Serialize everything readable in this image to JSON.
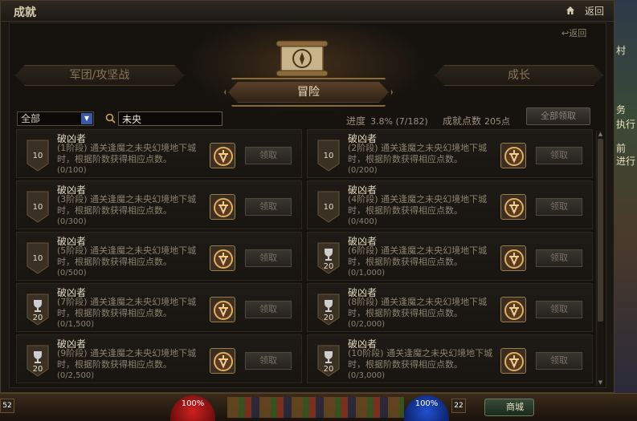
{
  "window": {
    "title": "成就",
    "back_label": "返回"
  },
  "panel": {
    "back_label": "返回"
  },
  "tabs": [
    {
      "label": "军团/攻坚战",
      "active": false
    },
    {
      "label": "冒险",
      "active": true
    },
    {
      "label": "成长",
      "active": false
    }
  ],
  "filter": {
    "selected": "全部",
    "search_value": "未央"
  },
  "summary": {
    "progress_label": "进度",
    "progress_value": "3.8% (7/182)",
    "points_label": "成就点数",
    "points_value": "205点",
    "claim_all_label": "全部领取"
  },
  "achievements": [
    {
      "name": "破凶者",
      "stage": "(1阶段)",
      "desc": "通关逢魔之未央幻境地下城时，根据阶数获得相应点数。",
      "progress": "(0/100)",
      "points": "10",
      "claim_label": "领取"
    },
    {
      "name": "破凶者",
      "stage": "(2阶段)",
      "desc": "通关逢魔之未央幻境地下城时，根据阶数获得相应点数。",
      "progress": "(0/200)",
      "points": "10",
      "claim_label": "领取"
    },
    {
      "name": "破凶者",
      "stage": "(3阶段)",
      "desc": "通关逢魔之未央幻境地下城时，根据阶数获得相应点数。",
      "progress": "(0/300)",
      "points": "10",
      "claim_label": "领取"
    },
    {
      "name": "破凶者",
      "stage": "(4阶段)",
      "desc": "通关逢魔之未央幻境地下城时，根据阶数获得相应点数。",
      "progress": "(0/400)",
      "points": "10",
      "claim_label": "领取"
    },
    {
      "name": "破凶者",
      "stage": "(5阶段)",
      "desc": "通关逢魔之未央幻境地下城时，根据阶数获得相应点数。",
      "progress": "(0/500)",
      "points": "10",
      "claim_label": "领取"
    },
    {
      "name": "破凶者",
      "stage": "(6阶段)",
      "desc": "通关逢魔之未央幻境地下城时，根据阶数获得相应点数。",
      "progress": "(0/1,000)",
      "points": "20",
      "claim_label": "领取"
    },
    {
      "name": "破凶者",
      "stage": "(7阶段)",
      "desc": "通关逢魔之未央幻境地下城时，根据阶数获得相应点数。",
      "progress": "(0/1,500)",
      "points": "20",
      "claim_label": "领取"
    },
    {
      "name": "破凶者",
      "stage": "(8阶段)",
      "desc": "通关逢魔之未央幻境地下城时，根据阶数获得相应点数。",
      "progress": "(0/2,000)",
      "points": "20",
      "claim_label": "领取"
    },
    {
      "name": "破凶者",
      "stage": "(9阶段)",
      "desc": "通关逢魔之未央幻境地下城时，根据阶数获得相应点数。",
      "progress": "(0/2,500)",
      "points": "20",
      "claim_label": "领取"
    },
    {
      "name": "破凶者",
      "stage": "(10阶段)",
      "desc": "通关逢魔之未央幻境地下城时，根据阶数获得相应点数。",
      "progress": "(0/3,000)",
      "points": "20",
      "claim_label": "领取"
    }
  ],
  "side": {
    "line1": "村",
    "line2": "务",
    "line3": "执行",
    "line4": "前",
    "line5": "进行"
  },
  "hud": {
    "hp_label": "100%",
    "mp_label": "100%",
    "level_left": "52",
    "level_mid": "22",
    "shop_label": "商城"
  }
}
